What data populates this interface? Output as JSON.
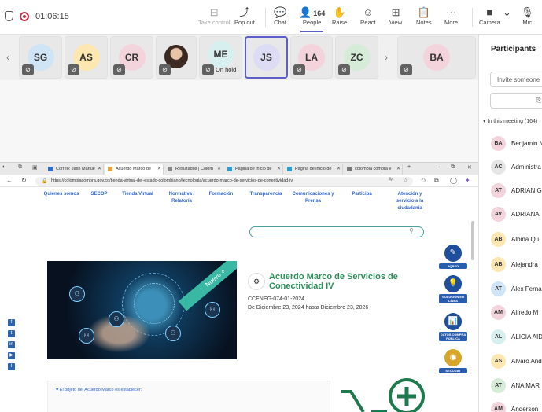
{
  "topbar": {
    "timer": "01:06:15",
    "buttons": [
      {
        "label": "Take control",
        "icon": "take-control-icon",
        "glyph": "⊟"
      },
      {
        "label": "Pop out",
        "icon": "pop-out-icon",
        "glyph": "⤴"
      },
      {
        "label": "Chat",
        "icon": "chat-icon",
        "glyph": "💬"
      },
      {
        "label": "People",
        "icon": "people-icon",
        "glyph": "👤"
      },
      {
        "label": "Raise",
        "icon": "raise-hand-icon",
        "glyph": "✋"
      },
      {
        "label": "React",
        "icon": "react-icon",
        "glyph": "☺"
      },
      {
        "label": "View",
        "icon": "view-icon",
        "glyph": "⊞"
      },
      {
        "label": "Notes",
        "icon": "notes-icon",
        "glyph": "📋"
      },
      {
        "label": "More",
        "icon": "more-icon",
        "glyph": "···"
      },
      {
        "label": "Camera",
        "icon": "camera-icon",
        "glyph": "■"
      },
      {
        "label": "Mic",
        "icon": "mic-icon",
        "glyph": "🎙"
      }
    ],
    "people_count": "164"
  },
  "strip": {
    "tiles": [
      {
        "initials": "SG",
        "color": "#cfe4f5"
      },
      {
        "initials": "AS",
        "color": "#fde7b0"
      },
      {
        "initials": "CR",
        "color": "#f3d4dc"
      },
      {
        "initials": "",
        "color": ""
      },
      {
        "initials": "ME",
        "color": "#d7f0ef",
        "status": "On hold"
      },
      {
        "initials": "JS",
        "color": "#dcdcf5"
      },
      {
        "initials": "LA",
        "color": "#f3d4dc"
      },
      {
        "initials": "ZC",
        "color": "#d6ecd8"
      },
      {
        "initials": "BA",
        "color": "#f3d4dc"
      }
    ]
  },
  "browser": {
    "tabs": [
      "Correo: Jasn Manue",
      "Acuerdo Marco de",
      "Resultados | Colom",
      "Página de inicio de",
      "Página de inicio de",
      "colombia compra e"
    ],
    "url": "https://colombiacompra.gov.co/tienda-virtual-del-estado-colombiano/tecnologia/acuerdo-marco-de-servicios-de-conectividad-iv",
    "nav": [
      {
        "label": "Quiénes somos"
      },
      {
        "label": "SECOP"
      },
      {
        "label": "Tienda Virtual"
      },
      {
        "label": "Normativa / Relatoría"
      },
      {
        "label": "Formación"
      },
      {
        "label": "Transparencia"
      },
      {
        "label": "Comunicaciones y Prensa"
      },
      {
        "label": "Participa"
      },
      {
        "label": "Atención y servicio a la ciudadanía"
      }
    ],
    "hero_ribbon": "Nuevo +",
    "am_title": "Acuerdo Marco de Servicios de Conectividad IV",
    "am_code": "CCENEG-074-01-2024",
    "am_dates": "De Diciembre 23, 2024 hasta Diciembre 23, 2026",
    "side_icons": [
      {
        "label": "PQRSD",
        "icon": "pqrsd-icon",
        "glyph": "✎"
      },
      {
        "label": "SOLUCIÓN EN LÍNEA",
        "icon": "solution-icon",
        "glyph": "💡"
      },
      {
        "label": "DATOS COMPRA PÚBLICA",
        "icon": "data-icon",
        "glyph": "📊"
      },
      {
        "label": "SECODAT",
        "icon": "secodat-icon",
        "glyph": "◉"
      }
    ],
    "objective": "♥ El objeto del Acuerdo Marco es establecer:"
  },
  "panel": {
    "title": "Participants",
    "invite_placeholder": "Invite someone",
    "section": "▾ In this meeting (164)",
    "people": [
      {
        "initials": "BA",
        "name": "Benjamin M",
        "color": "#f3d4dc"
      },
      {
        "initials": "AC",
        "name": "Administra",
        "color": "#e6e6e6"
      },
      {
        "initials": "AT",
        "name": "ADRIAN G",
        "color": "#f3d4dc"
      },
      {
        "initials": "AV",
        "name": "ADRIANA",
        "color": "#f3d4dc"
      },
      {
        "initials": "AB",
        "name": "Albina Qu",
        "color": "#fde7b0"
      },
      {
        "initials": "AB",
        "name": "Alejandra",
        "color": "#fde7b0"
      },
      {
        "initials": "AT",
        "name": "Alex Ferna",
        "color": "#cfe4f5"
      },
      {
        "initials": "AM",
        "name": "Alfredo M",
        "color": "#f3d4dc"
      },
      {
        "initials": "AL",
        "name": "ALICIA AID",
        "color": "#d7f0ef"
      },
      {
        "initials": "AS",
        "name": "Alvaro And",
        "color": "#fde7b0"
      },
      {
        "initials": "AT",
        "name": "ANA MAR",
        "color": "#d6ecd8"
      },
      {
        "initials": "AM",
        "name": "Anderson",
        "color": "#f3d4dc"
      }
    ]
  }
}
